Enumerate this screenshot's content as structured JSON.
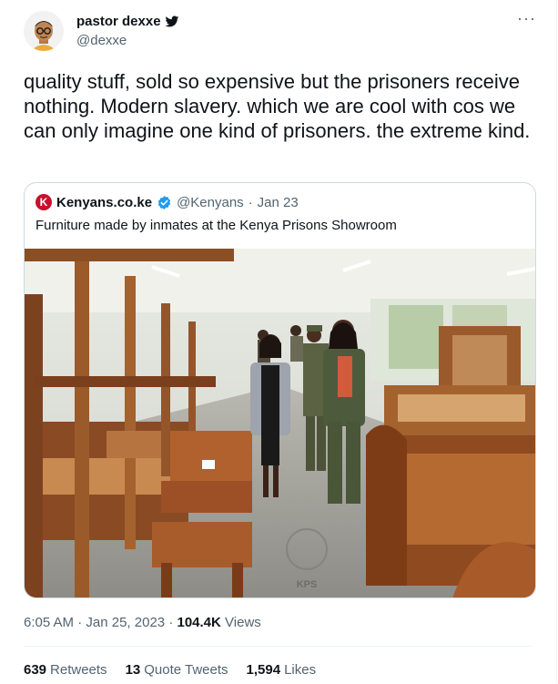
{
  "author": {
    "display_name": "pastor dexxe",
    "handle": "@dexxe",
    "more_label": "···",
    "verified_icon": "twitter-bird-icon"
  },
  "tweet": {
    "text": "quality stuff, sold so expensive but the prisoners receive nothing. Modern slavery. which we are cool with cos we can only imagine one kind of prisoners. the extreme kind."
  },
  "quoted": {
    "logo_letter": "K",
    "name": "Kenyans.co.ke",
    "handle": "@Kenyans",
    "separator": "·",
    "date": "Jan 23",
    "text": "Furniture made by inmates at the Kenya Prisons Showroom",
    "watermark": "KPS"
  },
  "meta": {
    "time": "6:05 AM",
    "separator": "·",
    "date": "Jan 25, 2023",
    "separator2": "·",
    "views_count": "104.4K",
    "views_label": "Views"
  },
  "stats": {
    "retweets_count": "639",
    "retweets_label": "Retweets",
    "quotes_count": "13",
    "quotes_label": "Quote Tweets",
    "likes_count": "1,594",
    "likes_label": "Likes"
  },
  "colors": {
    "text": "#0f1419",
    "secondary": "#536471",
    "verified": "#1d9bf0",
    "border": "#cfd9de",
    "brand_red": "#c8102e"
  }
}
